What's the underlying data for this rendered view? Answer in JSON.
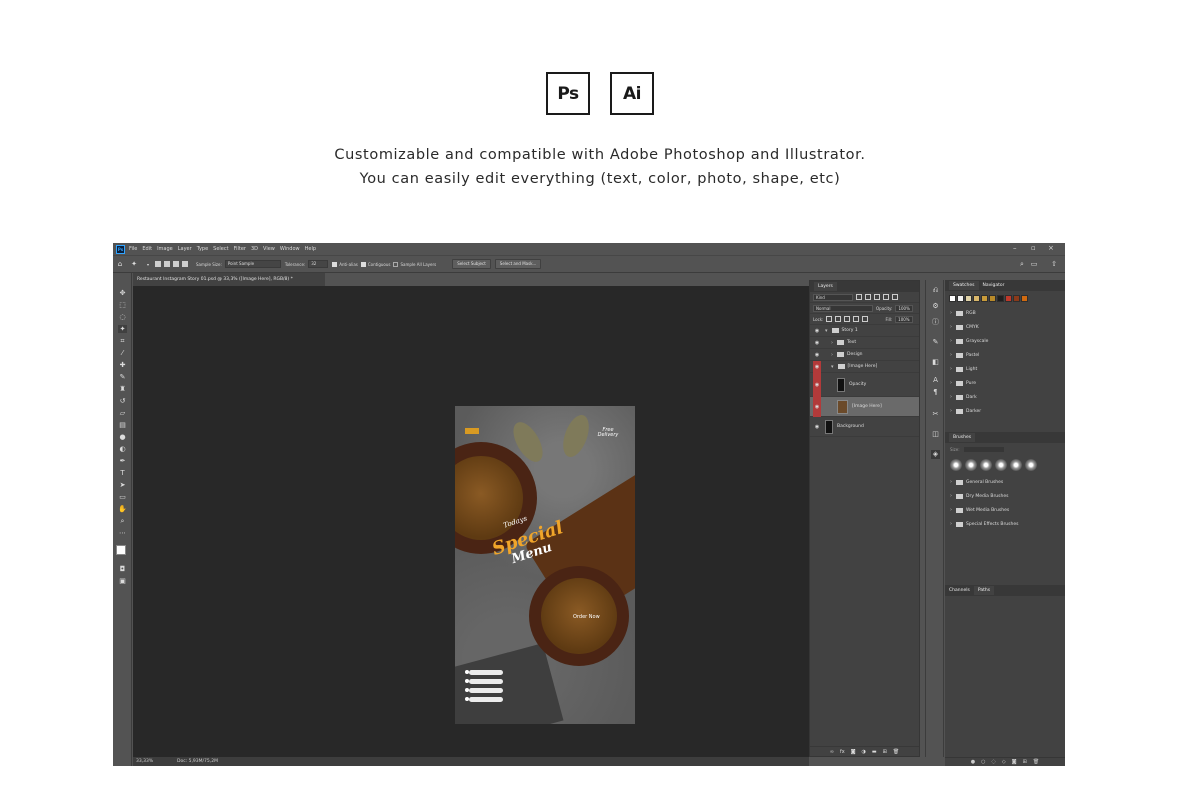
{
  "logos": {
    "ps": "Ps",
    "ai": "Ai"
  },
  "tagline": {
    "line1": "Customizable and compatible with Adobe Photoshop and Illustrator.",
    "line2": "You can easily edit everything (text, color, photo, shape, etc)"
  },
  "photoshop": {
    "menu": [
      "File",
      "Edit",
      "Image",
      "Layer",
      "Type",
      "Select",
      "Filter",
      "3D",
      "View",
      "Window",
      "Help"
    ],
    "options": {
      "sample_size_label": "Sample Size:",
      "sample_size_value": "Point Sample",
      "tolerance_label": "Tolerance:",
      "tolerance_value": "32",
      "anti_alias": "Anti-alias",
      "contiguous": "Contiguous",
      "sample_all_layers": "Sample All Layers",
      "select_subject": "Select Subject",
      "select_and_mask": "Select and Mask..."
    },
    "document_tab": "Restaurant Instagram Story 01.psd @ 33,3% ([Image Here], RGB/8) *",
    "status": {
      "zoom": "33,33%",
      "doc": "Doc: 5,93M/75,2M"
    },
    "artwork": {
      "free_delivery": "Free Delivery",
      "today": "Todays",
      "special": "Special",
      "menu": "Menu",
      "order_now": "Order Now"
    },
    "layers_panel": {
      "title": "Layers",
      "kind": "Kind",
      "blend": "Normal",
      "opacity_label": "Opacity:",
      "opacity_value": "100%",
      "lock_label": "Lock:",
      "fill_label": "Fill:",
      "fill_value": "100%",
      "layers": [
        {
          "name": "Story 1",
          "type": "group",
          "selected": false,
          "red": false
        },
        {
          "name": "Text",
          "type": "group",
          "selected": false,
          "red": false
        },
        {
          "name": "Design",
          "type": "group",
          "selected": false,
          "red": false
        },
        {
          "name": "[Image Here]",
          "type": "group",
          "selected": false,
          "red": true
        },
        {
          "name": "Opacity",
          "type": "layer",
          "selected": false,
          "red": true
        },
        {
          "name": "[Image Here]",
          "type": "image",
          "selected": true,
          "red": true
        },
        {
          "name": "Background",
          "type": "layer",
          "selected": false,
          "red": false
        }
      ]
    },
    "swatches_panel": {
      "tabs": [
        "Swatches",
        "Navigator"
      ],
      "colors": [
        "#ffffff",
        "#f2f2f2",
        "#e0d3a8",
        "#d9b76a",
        "#c99b3a",
        "#b88a2a",
        "#1f1f1f",
        "#c0392b",
        "#8a3a1a",
        "#d06a10"
      ],
      "folders": [
        "RGB",
        "CMYK",
        "Grayscale",
        "Pastel",
        "Light",
        "Pure",
        "Dark",
        "Darker"
      ]
    },
    "brushes_panel": {
      "title": "Brushes",
      "size_label": "Size:",
      "folders": [
        "General Brushes",
        "Dry Media Brushes",
        "Wet Media Brushes",
        "Special Effects Brushes"
      ]
    },
    "paths_panel": {
      "tabs": [
        "Channels",
        "Paths"
      ]
    }
  }
}
